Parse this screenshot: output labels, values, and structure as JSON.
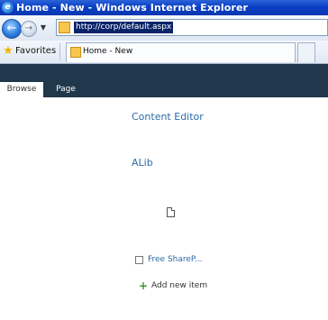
{
  "window": {
    "title": "Home - New - Windows Internet Explorer",
    "app_icon": "ie-icon"
  },
  "address_bar": {
    "url": "http://corp/default.aspx",
    "back_icon": "back-arrow-icon",
    "forward_icon": "forward-arrow-icon"
  },
  "favorites_bar": {
    "favorites_label": "Favorites",
    "tab_label": "Home - New"
  },
  "ribbon": {
    "background": "#21374c",
    "tabs": [
      {
        "label": "Browse",
        "selected": true
      },
      {
        "label": "Page",
        "selected": false
      }
    ]
  },
  "content": {
    "content_editor_title": "Content Editor",
    "alib_title": "ALib",
    "list_item_label": "Free ShareP...",
    "add_new_label": "Add new item",
    "link_color": "#2a6aa7"
  }
}
